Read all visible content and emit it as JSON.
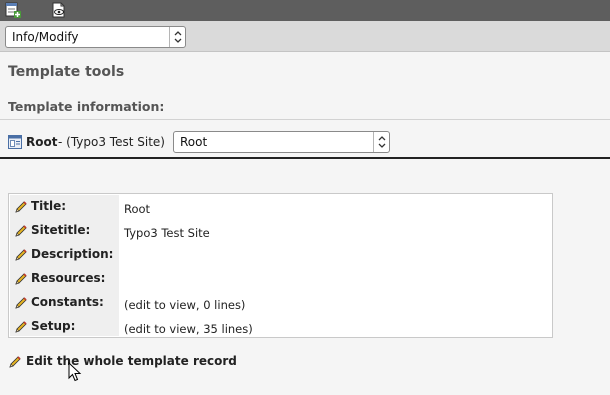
{
  "toolbar": {
    "icons": [
      "new-template-record-icon",
      "view-page-icon"
    ]
  },
  "module_select": {
    "value": "Info/Modify"
  },
  "page": {
    "title": "Template tools",
    "subtitle": "Template information:"
  },
  "root": {
    "name": "Root",
    "separator_text": "- (Typo3 Test Site)",
    "select_value": "Root"
  },
  "info_rows": [
    {
      "label": "Title:",
      "value": "Root"
    },
    {
      "label": "Sitetitle:",
      "value": "Typo3 Test Site"
    },
    {
      "label": "Description:",
      "value": ""
    },
    {
      "label": "Resources:",
      "value": ""
    },
    {
      "label": "Constants:",
      "value": "(edit to view, 0 lines)"
    },
    {
      "label": "Setup:",
      "value": "(edit to view, 35 lines)"
    }
  ],
  "edit_link": {
    "label": "Edit the whole template record"
  },
  "colors": {
    "toolbar_bg": "#5e5e5e",
    "selector_bar_bg": "#dadada",
    "page_bg": "#f5f5f5",
    "heading": "#555555"
  }
}
